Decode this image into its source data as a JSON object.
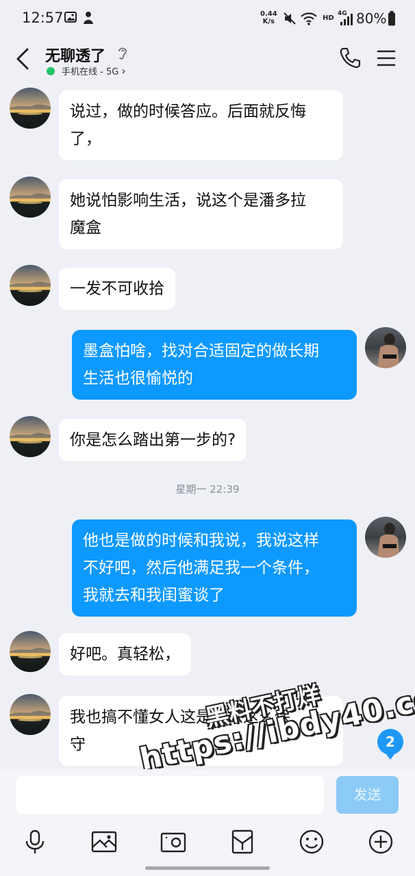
{
  "status_bar": {
    "time": "12:57",
    "speed_value": "0.44",
    "speed_unit": "K/s",
    "hd": "HD",
    "network": "4G",
    "battery": "80%"
  },
  "header": {
    "title": "无聊透了",
    "status": "手机在线 - 5G",
    "chevron": "›"
  },
  "messages": [
    {
      "side": "in",
      "text": "说过，做的时候答应。后面就反悔\n了，"
    },
    {
      "side": "in",
      "text": "她说怕影响生活，说这个是潘多拉\n魔盒"
    },
    {
      "side": "in",
      "text": "一发不可收拾"
    },
    {
      "side": "out",
      "text": "墨盒怕啥，找对合适固定的做长期\n生活也很愉悦的"
    },
    {
      "side": "in",
      "text": "你是怎么踏出第一步的?"
    },
    {
      "side": "out",
      "text": "他也是做的时候和我说，我说这样\n不好吧，然后他满足我一个条件，\n我就去和我闺蜜谈了"
    },
    {
      "side": "in",
      "text": "好吧。真轻松，"
    },
    {
      "side": "in",
      "text": "我也搞不懂女人这是怎么这么保\n守"
    }
  ],
  "timestamp": "星期一 22:39",
  "watermark": {
    "line1": "黑料不打烊",
    "line2": "https://ibdy40.com"
  },
  "unread_count": "2",
  "input": {
    "placeholder": "",
    "send_label": "发送"
  },
  "toolbar": [
    "mic-icon",
    "image-icon",
    "camera-icon",
    "red-packet-icon",
    "emoji-icon",
    "plus-icon"
  ],
  "colors": {
    "accent": "#0d99ff",
    "background": "#eef0f6",
    "send_disabled": "#8ccbf6",
    "online": "#25c46b"
  }
}
